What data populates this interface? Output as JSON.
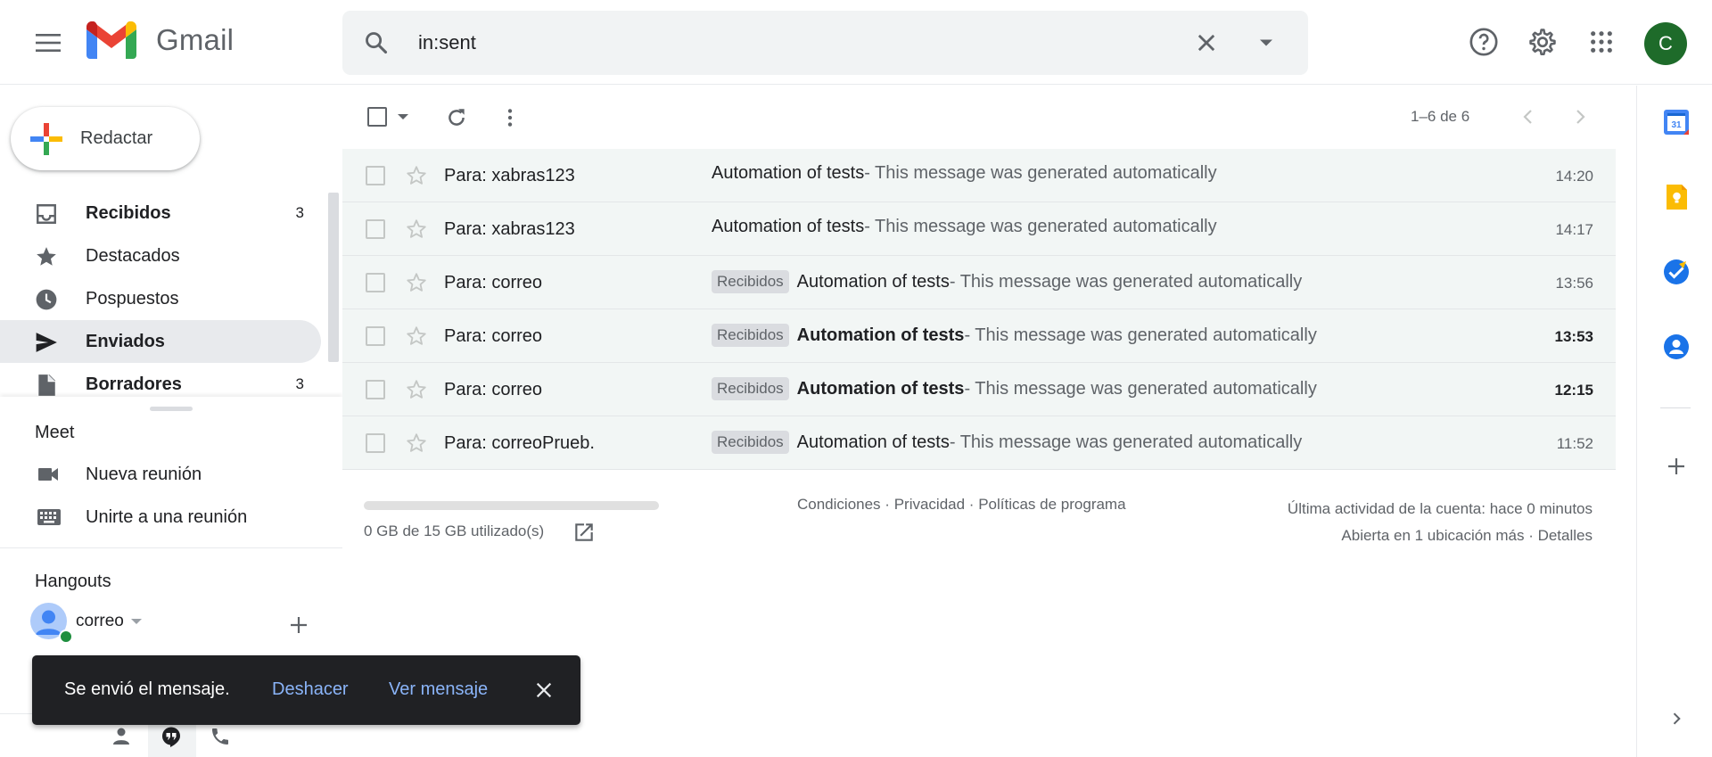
{
  "header": {
    "app_name": "Gmail",
    "search_value": "in:sent",
    "avatar_letter": "C"
  },
  "compose": {
    "label": "Redactar"
  },
  "nav": {
    "items": [
      {
        "label": "Recibidos",
        "count": "3",
        "bold": true,
        "icon": "inbox-icon"
      },
      {
        "label": "Destacados",
        "count": "",
        "bold": false,
        "icon": "star-icon"
      },
      {
        "label": "Pospuestos",
        "count": "",
        "bold": false,
        "icon": "clock-icon"
      },
      {
        "label": "Enviados",
        "count": "",
        "bold": true,
        "icon": "send-icon",
        "active": true
      },
      {
        "label": "Borradores",
        "count": "3",
        "bold": true,
        "icon": "draft-icon"
      }
    ]
  },
  "meet": {
    "title": "Meet",
    "new_meeting": "Nueva reunión",
    "join_meeting": "Unirte a una reunión"
  },
  "hangouts": {
    "title": "Hangouts",
    "user": "correo"
  },
  "toast": {
    "message": "Se envió el mensaje.",
    "undo": "Deshacer",
    "view": "Ver mensaje"
  },
  "toolbar": {
    "pager": "1–6 de 6"
  },
  "messages": [
    {
      "sender": "Para: xabras123",
      "badge": "",
      "subject": "Automation of tests",
      "snippet": " - This message was generated automatically",
      "time": "14:20",
      "unread": false
    },
    {
      "sender": "Para: xabras123",
      "badge": "",
      "subject": "Automation of tests",
      "snippet": " - This message was generated automatically",
      "time": "14:17",
      "unread": false
    },
    {
      "sender": "Para: correo",
      "badge": "Recibidos",
      "subject": "Automation of tests",
      "snippet": " - This message was generated automatically",
      "time": "13:56",
      "unread": false
    },
    {
      "sender": "Para: correo",
      "badge": "Recibidos",
      "subject": "Automation of tests",
      "snippet": " - This message was generated automatically",
      "time": "13:53",
      "unread": true
    },
    {
      "sender": "Para: correo",
      "badge": "Recibidos",
      "subject": "Automation of tests",
      "snippet": " - This message was generated automatically",
      "time": "12:15",
      "unread": true
    },
    {
      "sender": "Para: correoPrueb.",
      "badge": "Recibidos",
      "subject": "Automation of tests",
      "snippet": " - This message was generated automatically",
      "time": "11:52",
      "unread": false
    }
  ],
  "footer": {
    "storage": "0 GB de 15 GB utilizado(s)",
    "storage_fraction": 0,
    "terms": "Condiciones",
    "privacy": "Privacidad",
    "policies": "Políticas de programa",
    "activity_line1": "Última actividad de la cuenta: hace 0 minutos",
    "activity_line2": "Abierta en 1 ubicación más · Detalles"
  },
  "colors": {
    "accent_blue": "#8ab4f8",
    "avatar_green": "#1e6b2a",
    "row_read_bg": "#f2f6f5"
  }
}
